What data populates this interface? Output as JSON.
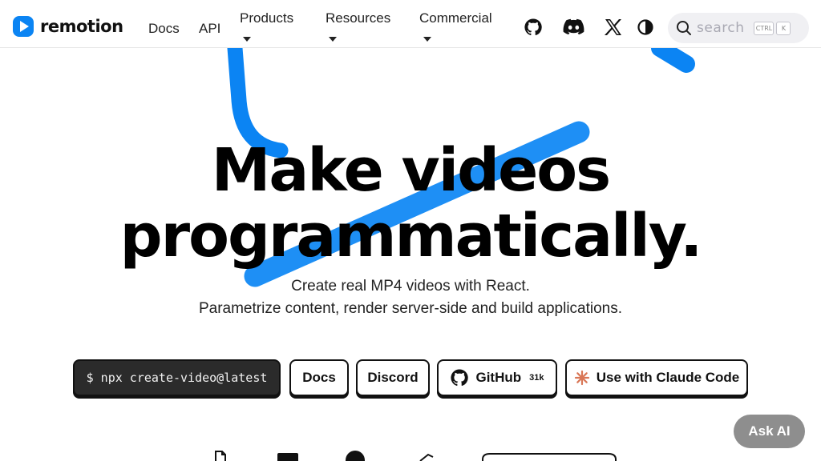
{
  "brand": {
    "name": "remotion",
    "accent": "#0b84f3"
  },
  "nav": {
    "docs": "Docs",
    "api": "API",
    "products": "Products",
    "resources": "Resources",
    "commercial": "Commercial",
    "icons": [
      "github-icon",
      "discord-icon",
      "x-icon",
      "theme-toggle-icon"
    ]
  },
  "search": {
    "placeholder": "search",
    "shortcut_ctrl": "CTRL",
    "shortcut_key": "K"
  },
  "hero": {
    "headline_line1": "Make videos",
    "headline_line2": "programmatically.",
    "sub_line1": "Create real MP4 videos with React.",
    "sub_line2": "Parametrize content, render server-side and build applications."
  },
  "cta": {
    "command": "$ npx create-video@latest",
    "docs": "Docs",
    "discord": "Discord",
    "github": "GitHub",
    "github_stars": "31k",
    "claude": "Use with Claude Code"
  },
  "ask_ai": "Ask AI"
}
